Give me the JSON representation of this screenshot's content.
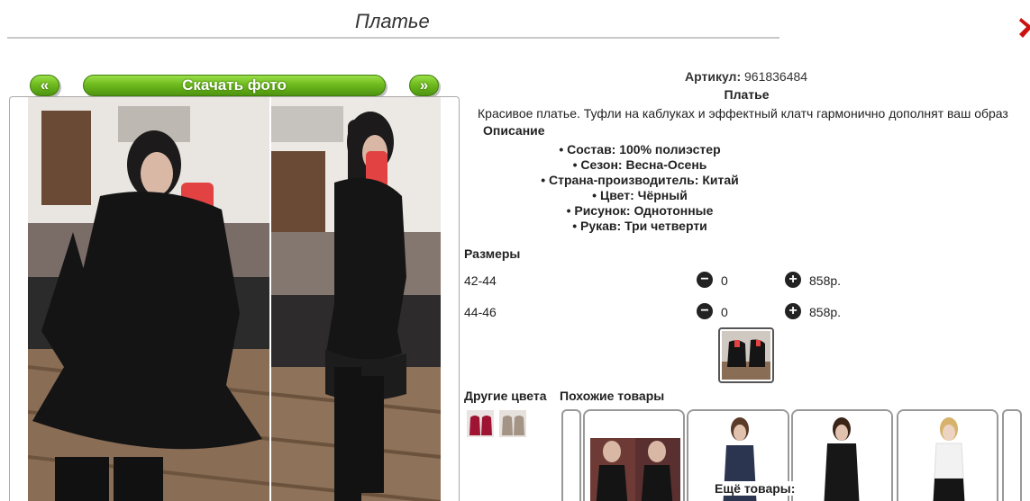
{
  "page": {
    "title": "Платье"
  },
  "gallery": {
    "prev_label": "«",
    "download_label": "Скачать фото",
    "next_label": "»"
  },
  "product": {
    "sku_label": "Артикул:",
    "sku_value": "961836484",
    "name": "Платье",
    "description": "Красивое платье. Туфли на каблуках и эффектный клатч гармонично дополнят ваш образ",
    "description_heading": "Описание",
    "properties": [
      "Состав: 100% полиэстер",
      "Сезон: Весна-Осень",
      "Страна-производитель: Китай",
      "Цвет: Чёрный",
      "Рисунок: Однотонные",
      "Рукав: Три четверти"
    ]
  },
  "sizes": {
    "heading": "Размеры",
    "rows": [
      {
        "size": "42-44",
        "qty": "0",
        "price": "858р."
      },
      {
        "size": "44-46",
        "qty": "0",
        "price": "858р."
      }
    ]
  },
  "other_colors": {
    "heading": "Другие цвета"
  },
  "similar": {
    "heading": "Похожие товары",
    "more_label": "Ещё товары:"
  },
  "colors": {
    "accent_green": "#6fbb1e",
    "close_red": "#cc1111"
  }
}
